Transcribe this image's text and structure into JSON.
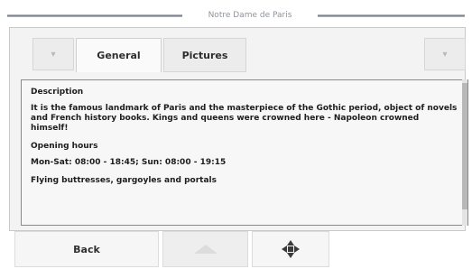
{
  "window": {
    "title": "Notre Dame de Paris"
  },
  "tabs": [
    {
      "label": "General",
      "selected": true
    },
    {
      "label": "Pictures",
      "selected": false
    }
  ],
  "tab_scroll": {
    "left_icon": "arrow-left-icon",
    "right_icon": "arrow-right-icon"
  },
  "content": {
    "description_heading": "Description",
    "description_text": "It is the famous landmark of Paris and the masterpiece of the Gothic period, object of novels and French history books. Kings and queens were crowned here - Napoleon crowned himself!",
    "opening_heading": "Opening hours",
    "opening_text": "Mon-Sat: 08:00 - 18:45; Sun: 08:00 - 19:15",
    "features_text": "Flying buttresses, gargoyles and portals"
  },
  "buttons": {
    "back_label": "Back",
    "up_icon": "arrow-up-icon",
    "navigate_icon": "crosshair-icon"
  },
  "colors": {
    "background": "#ffffff",
    "panel": "#f3f3f3",
    "text": "#1d1d1d"
  }
}
